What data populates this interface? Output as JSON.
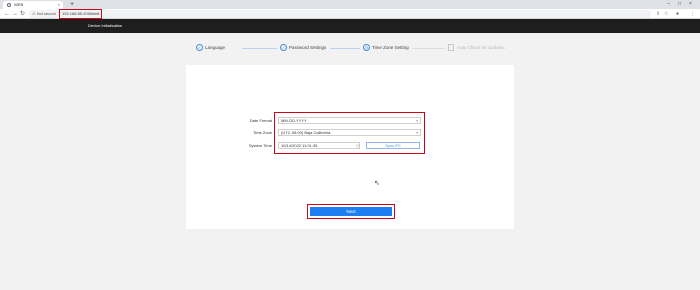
{
  "browser": {
    "tab_title": "WEB",
    "tab_close": "×",
    "new_tab": "+",
    "window_controls": [
      "–",
      "□",
      "×"
    ],
    "security_label": "Not secure",
    "url": "192.168.55.209/#/init",
    "nav_icons": [
      "back-icon",
      "forward-icon",
      "reload-icon"
    ],
    "toolbar_icons": [
      "share-icon",
      "bookmark-star-icon",
      "profile-icon",
      "menu-icon"
    ]
  },
  "app": {
    "header_title": "Device Initialization"
  },
  "steps": [
    {
      "label": "Language",
      "state": "done"
    },
    {
      "label": "Password Settings",
      "state": "done"
    },
    {
      "label": "Time Zone Setting",
      "state": "active"
    },
    {
      "label": "Auto Check for Updates",
      "state": "pending"
    }
  ],
  "form": {
    "date_format_label": "Date Format",
    "date_format_value": "MM-DD-YYYY",
    "time_zone_label": "Time Zone",
    "time_zone_value": "(UTC-08:00) Baja California",
    "system_time_label": "System Time",
    "system_time_value": "10/14/2022 11:01:35",
    "sync_button": "Sync PC"
  },
  "next_button": "Next",
  "colors": {
    "accent": "#1c7ef0",
    "highlight": "#d0021b",
    "header_bg": "#1e1e1e"
  }
}
